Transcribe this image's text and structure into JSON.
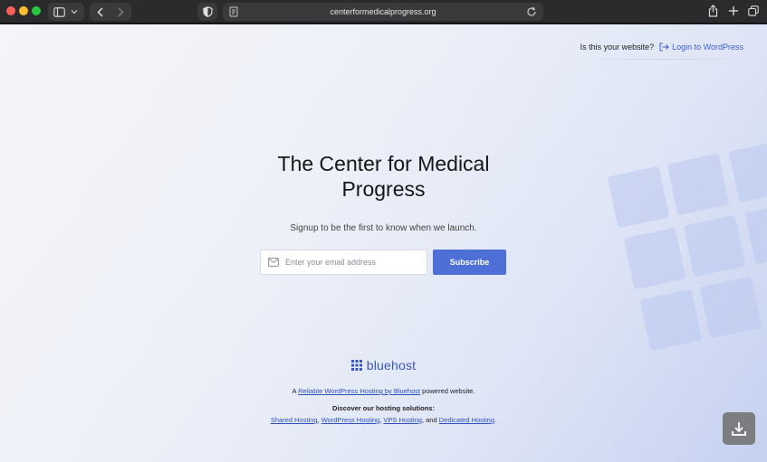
{
  "browser": {
    "url": "centerformedicalprogress.org"
  },
  "header": {
    "question": "Is this your website?",
    "login_label": "Login to WordPress"
  },
  "main": {
    "title_line1": "The Center for Medical",
    "title_line2": "Progress",
    "subtitle": "Signup to be the first to know when we launch.",
    "email_placeholder": "Enter your email address",
    "subscribe_label": "Subscribe"
  },
  "footer": {
    "brand": "bluehost",
    "powered_prefix": "A",
    "powered_link": "Reliable WordPress Hosting by Bluehost",
    "powered_suffix": "powered website.",
    "discover": "Discover our hosting solutions:",
    "links": {
      "shared": "Shared Hosting",
      "wordpress": "WordPress Hosting",
      "vps": "VPS Hosting",
      "dedicated": "Dedicated Hosting"
    },
    "sep1": ",",
    "sep2": ",",
    "sep3": ", and",
    "end": "."
  },
  "colors": {
    "accent": "#4e6fd6",
    "link": "#3b5fd8",
    "brand": "#3757c7"
  },
  "icons": [
    "sidebar-icon",
    "chevron-down-icon",
    "back-icon",
    "forward-icon",
    "shield-icon",
    "page-icon",
    "reload-icon",
    "share-icon",
    "new-tab-icon",
    "tabs-overview-icon",
    "login-icon",
    "mail-icon",
    "bluehost-logo-icon",
    "download-icon"
  ]
}
